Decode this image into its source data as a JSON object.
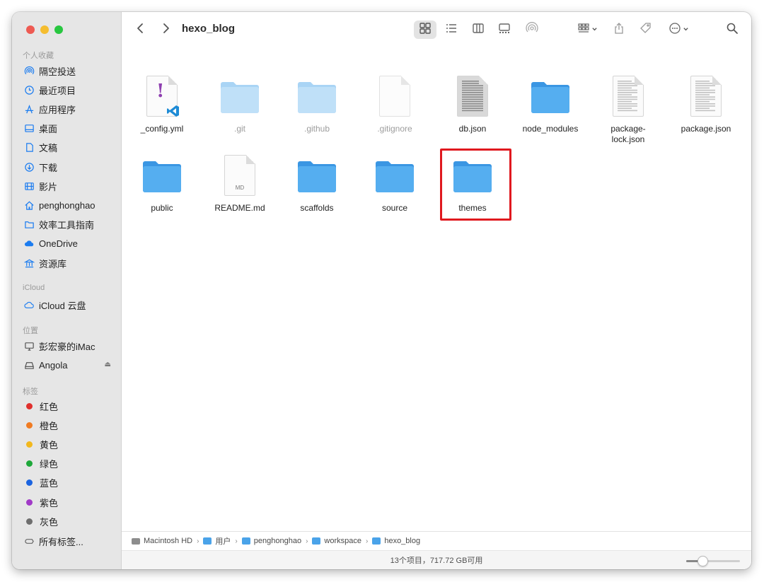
{
  "window": {
    "title": "hexo_blog"
  },
  "sidebar": {
    "favorites": [
      {
        "label": "隔空投送",
        "icon": "airdrop-icon"
      },
      {
        "label": "最近项目",
        "icon": "clock-icon"
      },
      {
        "label": "应用程序",
        "icon": "applications-icon"
      },
      {
        "label": "桌面",
        "icon": "desktop-icon"
      },
      {
        "label": "文稿",
        "icon": "document-icon"
      },
      {
        "label": "下载",
        "icon": "download-icon"
      },
      {
        "label": "影片",
        "icon": "film-icon"
      },
      {
        "label": "penghonghao",
        "icon": "home-icon"
      },
      {
        "label": "效率工具指南",
        "icon": "folder-icon"
      },
      {
        "label": "OneDrive",
        "icon": "cloud-icon"
      },
      {
        "label": "资源库",
        "icon": "library-icon"
      }
    ],
    "favorites_heading": "个人收藏",
    "icloud_heading": "iCloud",
    "icloud": [
      {
        "label": "iCloud 云盘",
        "icon": "icloud-icon"
      }
    ],
    "locations_heading": "位置",
    "locations": [
      {
        "label": "彭宏豪的iMac",
        "icon": "imac-icon"
      },
      {
        "label": "Angola",
        "icon": "drive-icon",
        "eject": "⏏"
      }
    ],
    "tags_heading": "标签",
    "tags": [
      {
        "label": "红色",
        "color": "#e0302d"
      },
      {
        "label": "橙色",
        "color": "#f07b22"
      },
      {
        "label": "黄色",
        "color": "#f2b81d"
      },
      {
        "label": "绿色",
        "color": "#1ea83a"
      },
      {
        "label": "蓝色",
        "color": "#1b64e0"
      },
      {
        "label": "紫色",
        "color": "#a13ac7"
      },
      {
        "label": "灰色",
        "color": "#6e6e6e"
      }
    ],
    "all_tags": "所有标签..."
  },
  "files": [
    {
      "name": "_config.yml",
      "kind": "yml",
      "hidden": false
    },
    {
      "name": ".git",
      "kind": "folder-light",
      "hidden": true
    },
    {
      "name": ".github",
      "kind": "folder-light",
      "hidden": true
    },
    {
      "name": ".gitignore",
      "kind": "blank-doc",
      "hidden": true
    },
    {
      "name": "db.json",
      "kind": "text-doc",
      "hidden": false
    },
    {
      "name": "node_modules",
      "kind": "folder",
      "hidden": false
    },
    {
      "name": "package-lock.json",
      "kind": "text-doc-light",
      "hidden": false
    },
    {
      "name": "package.json",
      "kind": "text-doc-light",
      "hidden": false
    },
    {
      "name": "public",
      "kind": "folder",
      "hidden": false
    },
    {
      "name": "README.md",
      "kind": "md-doc",
      "badge": "MD",
      "hidden": false
    },
    {
      "name": "scaffolds",
      "kind": "folder",
      "hidden": false
    },
    {
      "name": "source",
      "kind": "folder",
      "hidden": false
    },
    {
      "name": "themes",
      "kind": "folder",
      "hidden": false,
      "highlighted": true
    }
  ],
  "label_lines": {
    "package-lock.json": [
      "package-",
      "lock.json"
    ]
  },
  "pathbar": [
    {
      "label": "Macintosh HD",
      "icon": "hard-drive-icon"
    },
    {
      "label": "用户",
      "icon": "folder-icon"
    },
    {
      "label": "penghonghao",
      "icon": "folder-icon"
    },
    {
      "label": "workspace",
      "icon": "folder-icon"
    },
    {
      "label": "hexo_blog",
      "icon": "folder-icon"
    }
  ],
  "status": {
    "text": "13个项目，717.72 GB可用"
  },
  "icon_size_slider": {
    "value": 0.3
  },
  "colors": {
    "accent": "#1b7cf0",
    "folder": "#3d9be8",
    "highlight": "#e0191f"
  }
}
